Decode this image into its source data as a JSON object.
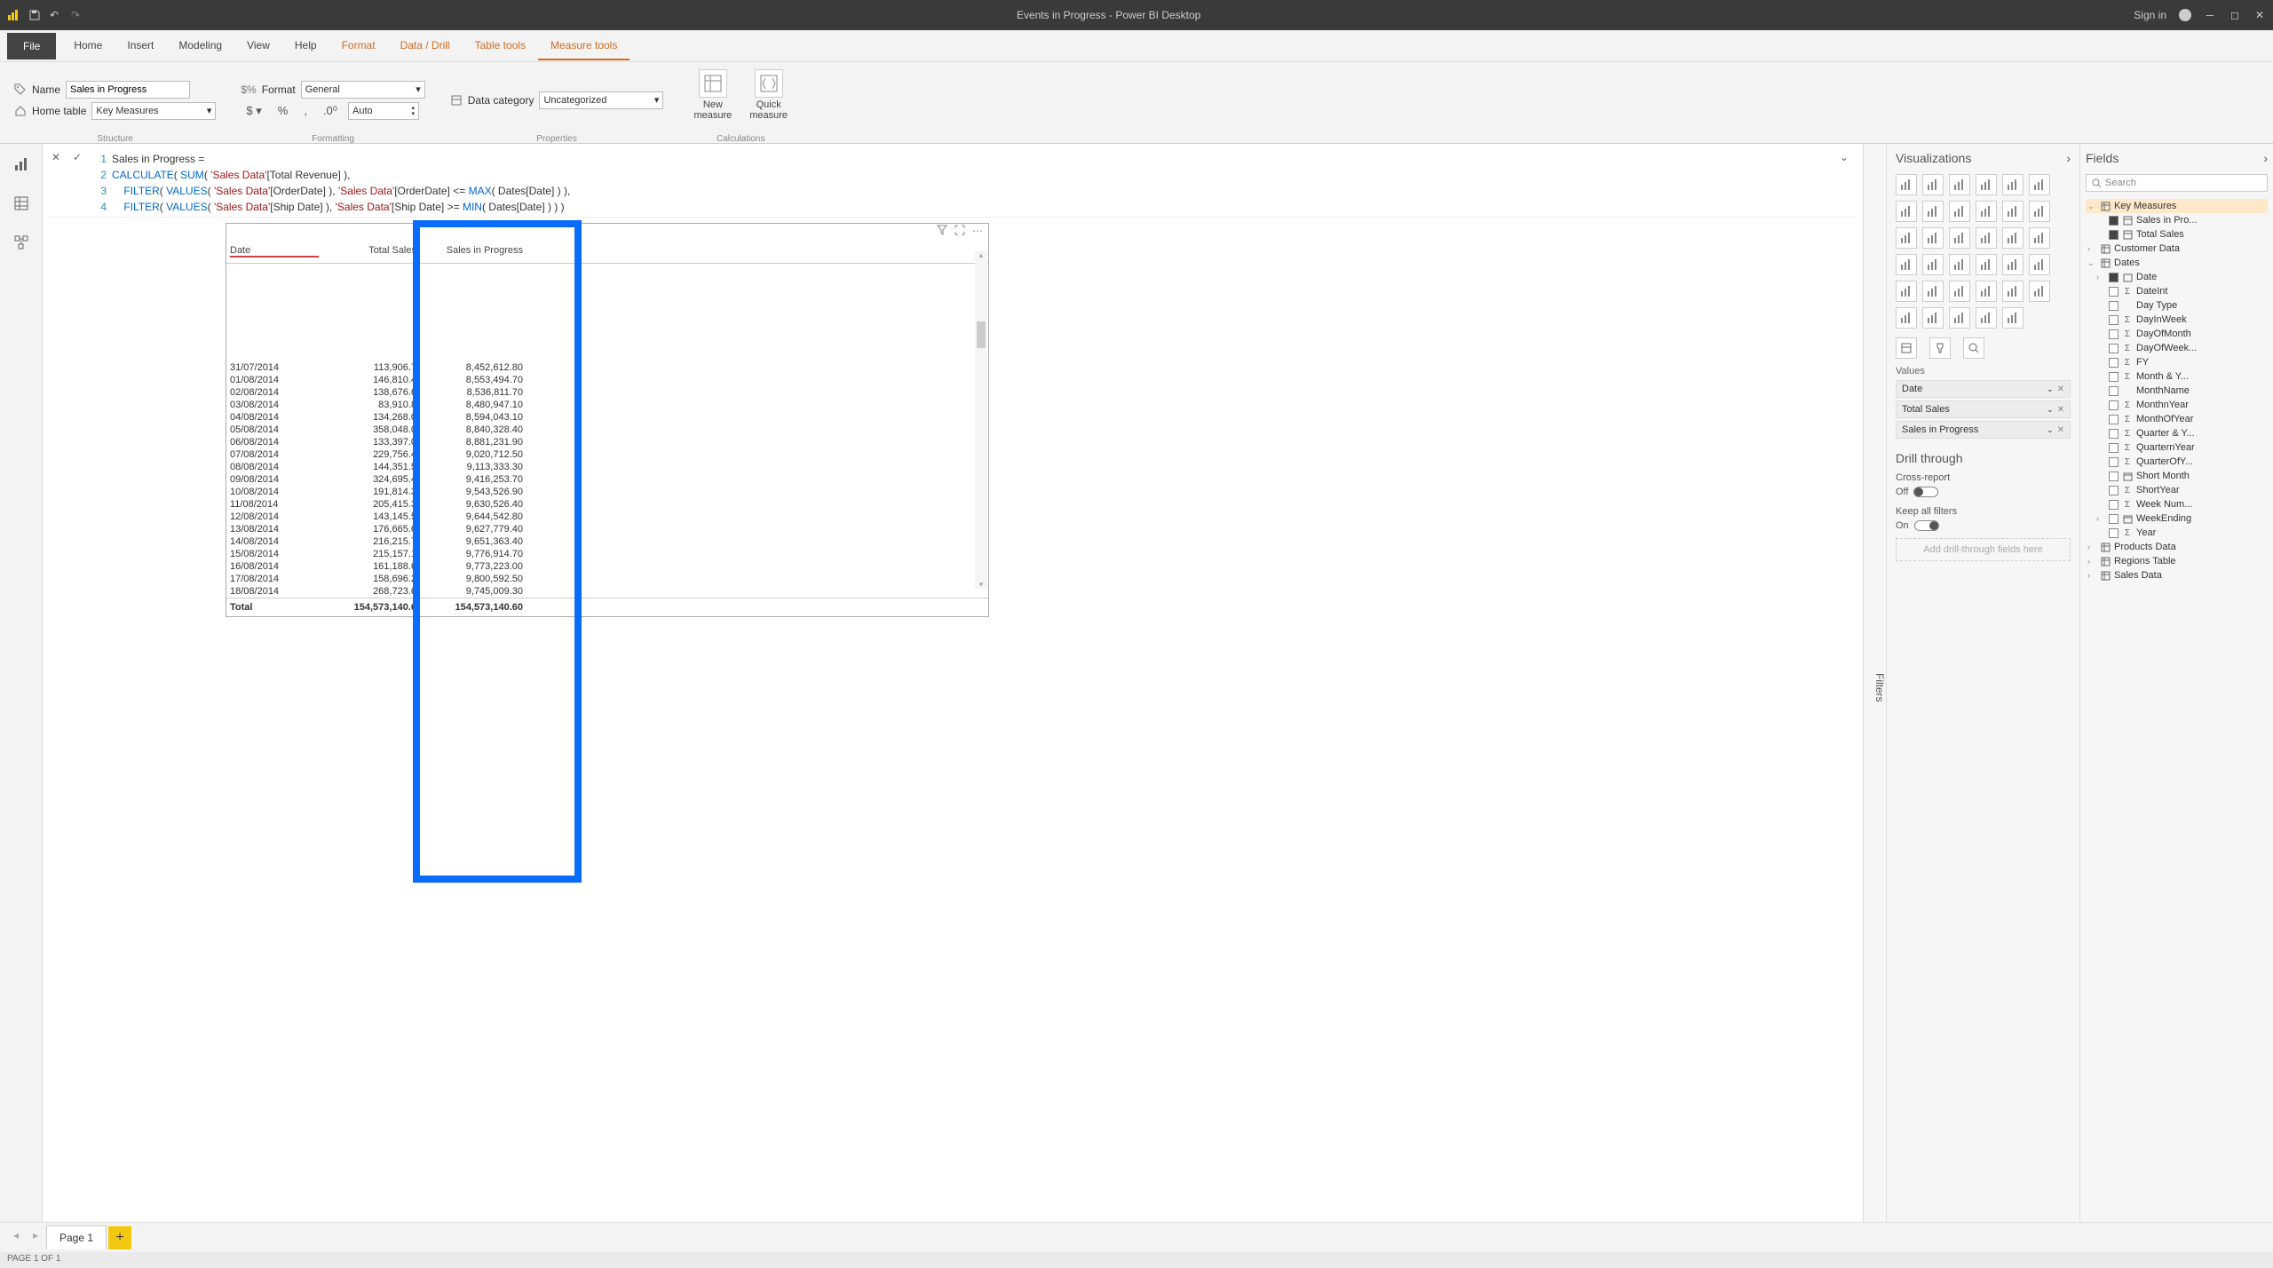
{
  "titlebar": {
    "title": "Events in Progress - Power BI Desktop",
    "signin": "Sign in"
  },
  "ribbon_tabs": {
    "file": "File",
    "items": [
      "Home",
      "Insert",
      "Modeling",
      "View",
      "Help",
      "Format",
      "Data / Drill",
      "Table tools",
      "Measure tools"
    ],
    "active": "Measure tools"
  },
  "ribbon": {
    "name_label": "Name",
    "name_value": "Sales in Progress",
    "home_table_label": "Home table",
    "home_table_value": "Key Measures",
    "structure_group": "Structure",
    "format_label": "Format",
    "format_value": "General",
    "auto_value": "Auto",
    "formatting_group": "Formatting",
    "data_category_label": "Data category",
    "data_category_value": "Uncategorized",
    "properties_group": "Properties",
    "new_measure": "New\nmeasure",
    "quick_measure": "Quick\nmeasure",
    "calculations_group": "Calculations"
  },
  "formula": {
    "lines": [
      {
        "n": "1",
        "text": "Sales in Progress ="
      },
      {
        "n": "2",
        "text": "CALCULATE( SUM( 'Sales Data'[Total Revenue] ),"
      },
      {
        "n": "3",
        "text": "    FILTER( VALUES( 'Sales Data'[OrderDate] ), 'Sales Data'[OrderDate] <= MAX( Dates[Date] ) ),"
      },
      {
        "n": "4",
        "text": "    FILTER( VALUES( 'Sales Data'[Ship Date] ), 'Sales Data'[Ship Date] >= MIN( Dates[Date] ) ) )"
      }
    ]
  },
  "table": {
    "headers": [
      "Date",
      "Total Sales",
      "Sales in Progress"
    ],
    "rows": [
      [
        "31/07/2014",
        "113,906.7",
        "8,452,612.80"
      ],
      [
        "01/08/2014",
        "146,810.4",
        "8,553,494.70"
      ],
      [
        "02/08/2014",
        "138,676.6",
        "8,536,811.70"
      ],
      [
        "03/08/2014",
        "83,910.8",
        "8,480,947.10"
      ],
      [
        "04/08/2014",
        "134,268.0",
        "8,594,043.10"
      ],
      [
        "05/08/2014",
        "358,048.0",
        "8,840,328.40"
      ],
      [
        "06/08/2014",
        "133,397.0",
        "8,881,231.90"
      ],
      [
        "07/08/2014",
        "229,756.4",
        "9,020,712.50"
      ],
      [
        "08/08/2014",
        "144,351.5",
        "9,113,333.30"
      ],
      [
        "09/08/2014",
        "324,695.4",
        "9,416,253.70"
      ],
      [
        "10/08/2014",
        "191,814.3",
        "9,543,526.90"
      ],
      [
        "11/08/2014",
        "205,415.3",
        "9,630,526.40"
      ],
      [
        "12/08/2014",
        "143,145.5",
        "9,644,542.80"
      ],
      [
        "13/08/2014",
        "176,665.6",
        "9,627,779.40"
      ],
      [
        "14/08/2014",
        "216,215.7",
        "9,651,363.40"
      ],
      [
        "15/08/2014",
        "215,157.1",
        "9,776,914.70"
      ],
      [
        "16/08/2014",
        "161,188.6",
        "9,773,223.00"
      ],
      [
        "17/08/2014",
        "158,696.2",
        "9,800,592.50"
      ],
      [
        "18/08/2014",
        "268,723.6",
        "9,745,009.30"
      ]
    ],
    "footer": [
      "Total",
      "154,573,140.6",
      "154,573,140.60"
    ]
  },
  "filters_pane": "Filters",
  "viz_pane": {
    "title": "Visualizations",
    "values_label": "Values",
    "wells": [
      "Date",
      "Total Sales",
      "Sales in Progress"
    ],
    "drill_through": "Drill through",
    "cross_report": "Cross-report",
    "off": "Off",
    "keep_filters": "Keep all filters",
    "on": "On",
    "drill_drop": "Add drill-through fields here"
  },
  "fields_pane": {
    "title": "Fields",
    "search": "Search",
    "tables": [
      {
        "name": "Key Measures",
        "expanded": true,
        "active": true,
        "fields": [
          {
            "name": "Sales in Pro...",
            "checked": true,
            "icon": "measure"
          },
          {
            "name": "Total Sales",
            "checked": true,
            "icon": "measure"
          }
        ]
      },
      {
        "name": "Customer Data",
        "expanded": false
      },
      {
        "name": "Dates",
        "expanded": true,
        "fields": [
          {
            "name": "Date",
            "checked": true,
            "icon": "hierarchy",
            "expandable": true
          },
          {
            "name": "DateInt",
            "checked": false,
            "icon": "sigma"
          },
          {
            "name": "Day Type",
            "checked": false
          },
          {
            "name": "DayInWeek",
            "checked": false,
            "icon": "sigma"
          },
          {
            "name": "DayOfMonth",
            "checked": false,
            "icon": "sigma"
          },
          {
            "name": "DayOfWeek...",
            "checked": false,
            "icon": "sigma"
          },
          {
            "name": "FY",
            "checked": false,
            "icon": "sigma"
          },
          {
            "name": "Month & Y...",
            "checked": false,
            "icon": "sigma"
          },
          {
            "name": "MonthName",
            "checked": false
          },
          {
            "name": "MonthnYear",
            "checked": false,
            "icon": "sigma"
          },
          {
            "name": "MonthOfYear",
            "checked": false,
            "icon": "sigma"
          },
          {
            "name": "Quarter & Y...",
            "checked": false,
            "icon": "sigma"
          },
          {
            "name": "QuarternYear",
            "checked": false,
            "icon": "sigma"
          },
          {
            "name": "QuarterOfY...",
            "checked": false,
            "icon": "sigma"
          },
          {
            "name": "Short Month",
            "checked": false,
            "icon": "calendar"
          },
          {
            "name": "ShortYear",
            "checked": false,
            "icon": "sigma"
          },
          {
            "name": "Week Num...",
            "checked": false,
            "icon": "sigma"
          },
          {
            "name": "WeekEnding",
            "checked": false,
            "icon": "calendar",
            "expandable": true
          },
          {
            "name": "Year",
            "checked": false,
            "icon": "sigma"
          }
        ]
      },
      {
        "name": "Products Data",
        "expanded": false
      },
      {
        "name": "Regions Table",
        "expanded": false
      },
      {
        "name": "Sales Data",
        "expanded": false
      }
    ]
  },
  "pages": {
    "page1": "Page 1"
  },
  "status": "PAGE 1 OF 1"
}
